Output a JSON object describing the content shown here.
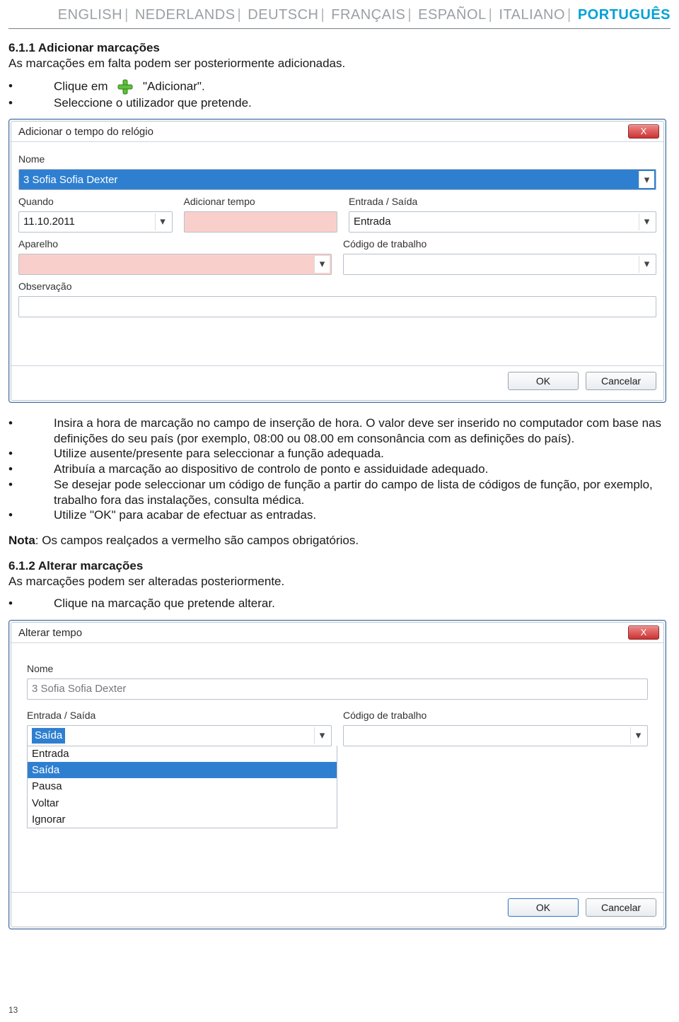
{
  "langs": {
    "en": "ENGLISH",
    "nl": "NEDERLANDS",
    "de": "DEUTSCH",
    "fr": "FRANÇAIS",
    "es": "ESPAÑOL",
    "it": "ITALIANO",
    "pt": "PORTUGUÊS"
  },
  "section611": {
    "heading": "6.1.1 Adicionar marcações",
    "intro": "As marcações em falta podem ser posteriormente adicionadas.",
    "bullets_top": {
      "b1a": "Clique em",
      "b1b": "\"Adicionar\".",
      "b2": "Seleccione o utilizador que pretende."
    },
    "bullets_mid": {
      "m1": "Insira a hora de marcação no campo de inserção de hora. O valor deve ser inserido no computador com base nas definições do seu país (por exemplo, 08:00 ou 08.00 em consonância com as definições do país).",
      "m2": "Utilize ausente/presente para seleccionar a função adequada.",
      "m3": "Atribuía a marcação ao dispositivo de controlo de ponto e assiduidade adequado.",
      "m4": "Se desejar pode seleccionar um código de função a partir do campo de lista de códigos de função, por exemplo, trabalho fora das instalações, consulta médica.",
      "m5": "Utilize \"OK\" para acabar de efectuar as entradas."
    },
    "note_label": "Nota",
    "note_text": ": Os campos realçados a vermelho são campos obrigatórios."
  },
  "section612": {
    "heading": "6.1.2 Alterar marcações",
    "intro": "As marcações podem ser alteradas posteriormente.",
    "bullet": "Clique na marcação que pretende alterar."
  },
  "dialog1": {
    "title": "Adicionar o tempo do relógio",
    "close": "X",
    "labels": {
      "nome": "Nome",
      "quando": "Quando",
      "adicionar_tempo": "Adicionar tempo",
      "entrada_saida": "Entrada / Saída",
      "aparelho": "Aparelho",
      "codigo": "Código de trabalho",
      "observacao": "Observação"
    },
    "values": {
      "nome": "3 Sofia Sofia Dexter",
      "quando": "11.10.2011",
      "entrada_saida": "Entrada"
    },
    "buttons": {
      "ok": "OK",
      "cancelar": "Cancelar"
    }
  },
  "dialog2": {
    "title": "Alterar tempo",
    "close": "X",
    "labels": {
      "nome": "Nome",
      "entrada_saida": "Entrada / Saída",
      "codigo": "Código de trabalho"
    },
    "values": {
      "nome": "3 Sofia Sofia Dexter",
      "entrada_saida": "Saída"
    },
    "options": {
      "o1": "Entrada",
      "o2": "Saída",
      "o3": "Pausa",
      "o4": "Voltar",
      "o5": "Ignorar"
    },
    "buttons": {
      "ok": "OK",
      "cancelar": "Cancelar"
    }
  },
  "page_number": "13"
}
